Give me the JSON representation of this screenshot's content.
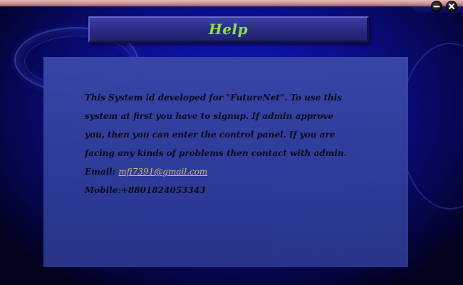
{
  "window": {
    "title": "Help",
    "minimize_symbol": "−",
    "close_symbol": "×"
  },
  "help": {
    "lines": [
      "This System id developed for \"FutureNet\". To use this",
      "system at first you have to signup. If admin approve",
      "you, then you can enter the control panel. If you are",
      "facing any kinds of problems then contact with admin."
    ],
    "email_label": "Email:",
    "email_value": "mfi7391@gmail.com",
    "mobile_label": "Mobile:",
    "mobile_value": "+8801824053343"
  },
  "colors": {
    "title_text": "#8ee04a",
    "email_link": "#d6c57a",
    "body_text": "#0a0a14"
  },
  "icons": {
    "minimize": "minimize-icon",
    "close": "close-icon"
  }
}
